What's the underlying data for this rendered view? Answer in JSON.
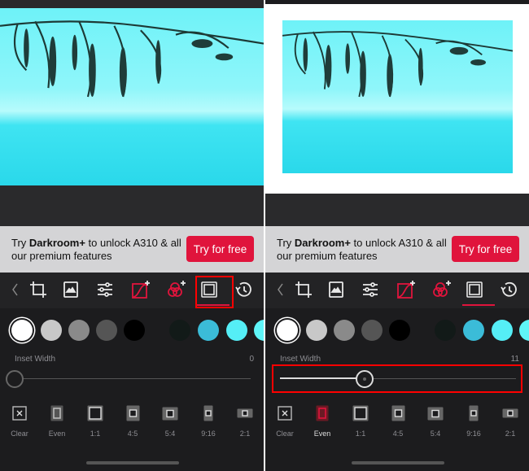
{
  "panels": [
    {
      "ad": {
        "prefix": "Try ",
        "brand": "Darkroom+",
        "suffix": " to unlock A310 & all our premium features",
        "button": "Try for free"
      },
      "inset": {
        "label": "Inset Width",
        "value": "0",
        "fraction": 0.0
      },
      "selected_tool": "frame",
      "selected_frame": null
    },
    {
      "ad": {
        "prefix": "Try ",
        "brand": "Darkroom+",
        "suffix": " to unlock A310 & all our premium features",
        "button": "Try for free"
      },
      "inset": {
        "label": "Inset Width",
        "value": "11",
        "fraction": 0.36
      },
      "selected_tool": "frame",
      "selected_frame": "Even"
    }
  ],
  "tools": [
    "back-chevron",
    "crop",
    "image-filter",
    "adjust-sliders",
    "curves",
    "color-mixer",
    "frame",
    "history"
  ],
  "swatch_colors": [
    "#ffffff",
    "#c8c8c8",
    "#8a8a8a",
    "#555555",
    "#000000",
    "#121a18",
    "#3bbcd8",
    "#55eef6",
    "#5ff5f8"
  ],
  "frames": [
    "Clear",
    "Even",
    "1:1",
    "4:5",
    "5:4",
    "9:16",
    "2:1"
  ],
  "colors": {
    "accent": "#e0143c",
    "highlight": "#ff0000"
  }
}
